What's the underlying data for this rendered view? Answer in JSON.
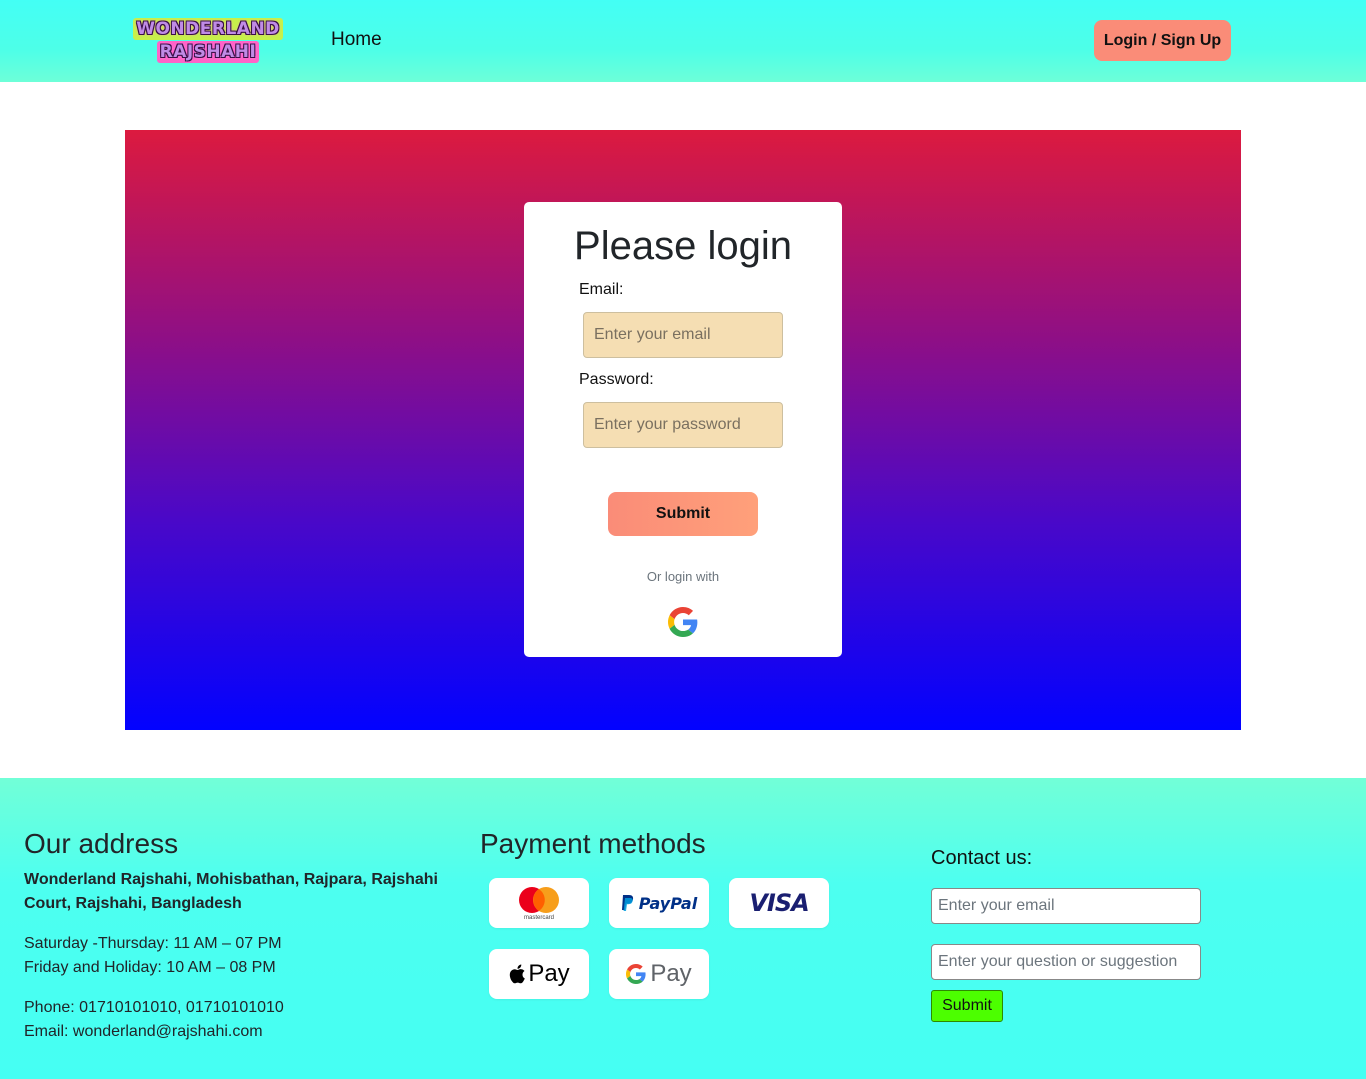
{
  "header": {
    "logo_line1": "WONDERLAND",
    "logo_line2": "RAJSHAHI",
    "nav_home": "Home",
    "login_button": "Login / Sign Up"
  },
  "login_card": {
    "title": "Please login",
    "email_label": "Email:",
    "email_placeholder": "Enter your email",
    "password_label": "Password:",
    "password_placeholder": "Enter your password",
    "submit_label": "Submit",
    "or_text": "Or login with",
    "social_icon": "google-icon"
  },
  "footer": {
    "address": {
      "title": "Our address",
      "line1": "Wonderland Rajshahi, Mohisbathan, Rajpara, Rajshahi",
      "line2": "Court, Rajshahi, Bangladesh",
      "hours1": "Saturday -Thursday: 11 AM – 07 PM",
      "hours2": "Friday and Holiday: 10 AM – 08 PM",
      "phone": "Phone: 01710101010, 01710101010",
      "email": "Email: wonderland@rajshahi.com"
    },
    "payment": {
      "title": "Payment methods",
      "mastercard_caption": "mastercard",
      "paypal": "PayPal",
      "visa": "VISA",
      "applepay": "Pay",
      "gpay": "Pay"
    },
    "contact": {
      "title": "Contact us:",
      "email_placeholder": "Enter your email",
      "question_placeholder": "Enter your question or suggestion",
      "submit_label": "Submit"
    }
  },
  "colors": {
    "header_bg": "#43fff5",
    "accent_salmon": "#fa8c78",
    "hero_top": "#dc1a3f",
    "hero_bottom": "#0202ff",
    "input_bg": "#f5deb3",
    "contact_submit": "#4cff00"
  }
}
